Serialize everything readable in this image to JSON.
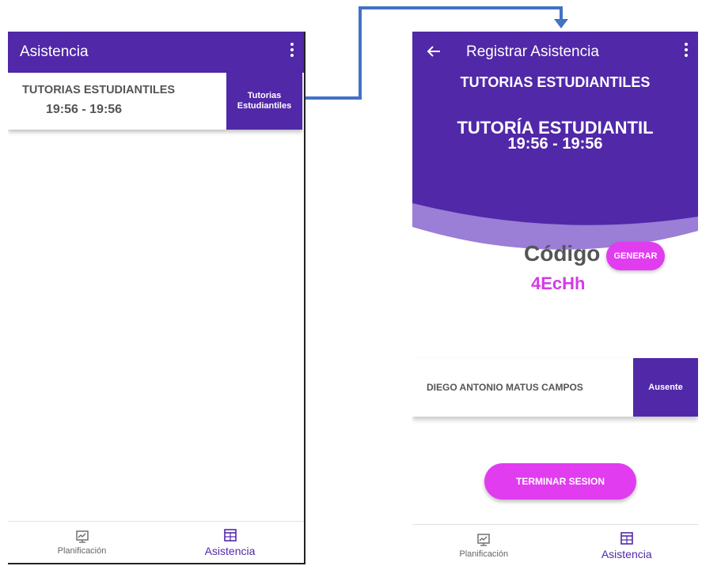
{
  "left_screen": {
    "appbar": {
      "title": "Asistencia"
    },
    "session": {
      "title": "TUTORIAS ESTUDIANTILES",
      "time": "19:56 - 19:56",
      "badge_line1": "Tutorias",
      "badge_line2": "Estudiantiles"
    },
    "bottom_nav": [
      {
        "label": "Planificación",
        "icon": "planning-icon",
        "active": false
      },
      {
        "label": "Asistencia",
        "icon": "table-icon",
        "active": true
      }
    ]
  },
  "right_screen": {
    "appbar": {
      "title": "Registrar Asistencia"
    },
    "hero": {
      "course": "TUTORIAS ESTUDIANTILES",
      "type": "TUTORÍA ESTUDIANTIL",
      "time": "19:56 - 19:56"
    },
    "code": {
      "label": "Código",
      "button": "GENERAR",
      "value": "4EcHh"
    },
    "student": {
      "name": "DIEGO ANTONIO MATUS CAMPOS",
      "status": "Ausente"
    },
    "finish_button": "TERMINAR SESION",
    "bottom_nav": [
      {
        "label": "Planificación",
        "icon": "planning-icon",
        "active": false
      },
      {
        "label": "Asistencia",
        "icon": "table-icon",
        "active": true
      }
    ]
  },
  "colors": {
    "primary": "#5128a8",
    "accent": "#e13cf0",
    "wave": "#9b7ed6",
    "connector": "#4472c4"
  }
}
